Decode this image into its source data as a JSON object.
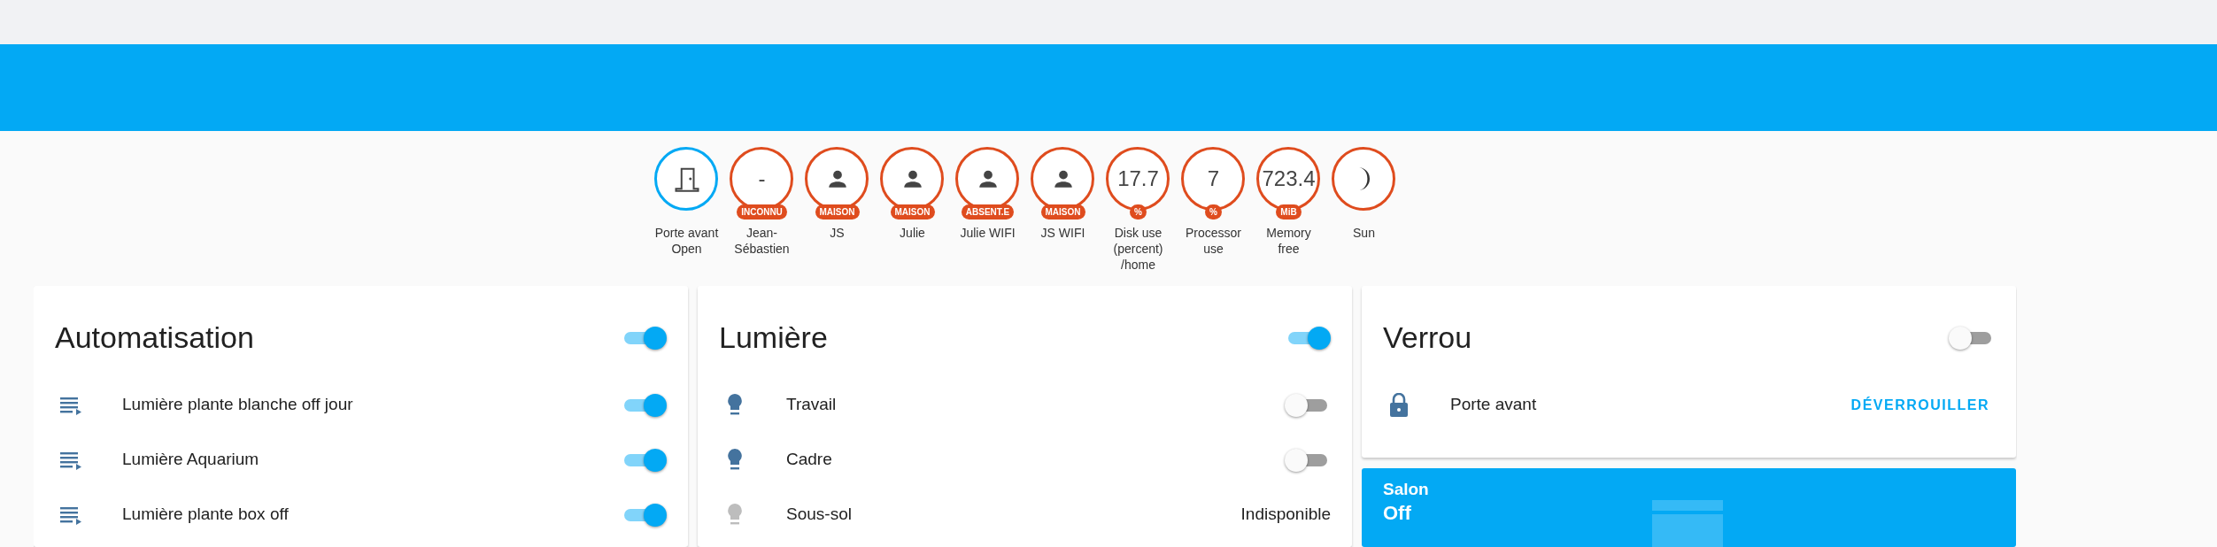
{
  "badges": [
    {
      "kind": "door",
      "label": "Porte avant Open",
      "color": "#03a9f4"
    },
    {
      "kind": "value",
      "value": "-",
      "chip": "INCONNU",
      "label": "Jean-Sébastien",
      "color": "#df4c1e"
    },
    {
      "kind": "person",
      "chip": "MAISON",
      "label": "JS",
      "color": "#df4c1e"
    },
    {
      "kind": "person",
      "chip": "MAISON",
      "label": "Julie",
      "color": "#df4c1e"
    },
    {
      "kind": "person",
      "chip": "ABSENT.E",
      "label": "Julie WIFI",
      "color": "#df4c1e"
    },
    {
      "kind": "person",
      "chip": "MAISON",
      "label": "JS WIFI",
      "color": "#df4c1e"
    },
    {
      "kind": "value",
      "value": "17.7",
      "chip": "%",
      "label": "Disk use (percent) /home",
      "color": "#df4c1e"
    },
    {
      "kind": "value",
      "value": "7",
      "chip": "%",
      "label": "Processor use",
      "color": "#df4c1e"
    },
    {
      "kind": "value",
      "value": "723.4",
      "chip": "MiB",
      "label": "Memory free",
      "color": "#df4c1e"
    },
    {
      "kind": "moon",
      "label": "Sun",
      "color": "#df4c1e"
    }
  ],
  "cards": [
    {
      "kind": "automation",
      "title": "Automatisation",
      "on": true,
      "rows": [
        {
          "kind": "toggle",
          "name": "Lumière plante blanche off jour",
          "on": true
        },
        {
          "kind": "toggle",
          "name": "Lumière Aquarium",
          "on": true
        },
        {
          "kind": "toggle",
          "name": "Lumière plante box off",
          "on": true
        }
      ]
    },
    {
      "kind": "light",
      "title": "Lumière",
      "on": true,
      "rows": [
        {
          "kind": "toggle",
          "name": "Travail",
          "on": false
        },
        {
          "kind": "toggle",
          "name": "Cadre",
          "on": false
        },
        {
          "kind": "state",
          "name": "Sous-sol",
          "state": "Indisponible",
          "disabled": true
        }
      ]
    },
    {
      "kind": "lock",
      "title": "Verrou",
      "on": false,
      "rows": [
        {
          "kind": "action",
          "name": "Porte avant",
          "action": "DÉVERROUILLER"
        }
      ]
    }
  ],
  "scene": {
    "title": "Salon",
    "state": "Off"
  }
}
